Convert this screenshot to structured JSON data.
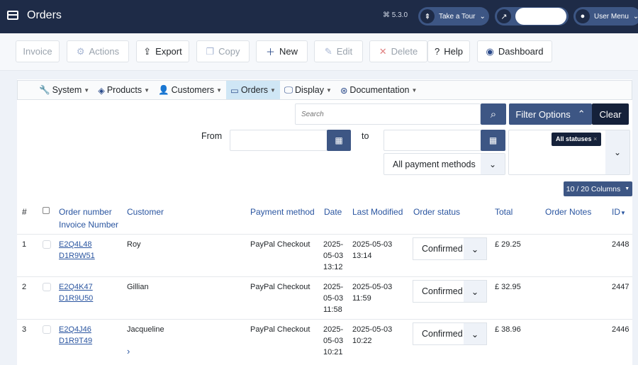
{
  "header": {
    "title": "Orders",
    "version": "5.3.0",
    "tour": "Take a Tour",
    "user_menu": "User Menu"
  },
  "toolbar": {
    "invoice": "Invoice",
    "actions": "Actions",
    "export": "Export",
    "copy": "Copy",
    "new": "New",
    "edit": "Edit",
    "delete": "Delete",
    "help": "Help",
    "dashboard": "Dashboard"
  },
  "menu": {
    "system": "System",
    "products": "Products",
    "customers": "Customers",
    "orders": "Orders",
    "display": "Display",
    "documentation": "Documentation"
  },
  "filters": {
    "search_placeholder": "Search",
    "filter_options": "Filter Options",
    "clear": "Clear",
    "from": "From",
    "to": "to",
    "payment": "All payment methods",
    "status_tag": "All statuses",
    "columns": "10 / 20  Columns"
  },
  "table": {
    "headers": {
      "num": "#",
      "order": "Order number",
      "invoice": "Invoice Number",
      "customer": "Customer",
      "payment": "Payment method",
      "date": "Date",
      "modified": "Last Modified",
      "status": "Order status",
      "total": "Total",
      "notes": "Order Notes",
      "id": "ID"
    },
    "rows": [
      {
        "num": "1",
        "order": "E2Q4L48",
        "invoice": "D1R9W51",
        "customer": "Roy",
        "payment": "PayPal Checkout",
        "date1": "2025-",
        "date2": "05-03",
        "date3": "13:12",
        "mod1": "2025-05-03",
        "mod2": "13:14",
        "status": "Confirmed",
        "total": "£ 29.25",
        "id": "2448"
      },
      {
        "num": "2",
        "order": "E2Q4K47",
        "invoice": "D1R9U50",
        "customer": "Gillian",
        "payment": "PayPal Checkout",
        "date1": "2025-",
        "date2": "05-03",
        "date3": "11:58",
        "mod1": "2025-05-03",
        "mod2": "11:59",
        "status": "Confirmed",
        "total": "£ 32.95",
        "id": "2447"
      },
      {
        "num": "3",
        "order": "E2Q4J46",
        "invoice": "D1R9T49",
        "customer": "Jacqueline",
        "payment": "PayPal Checkout",
        "date1": "2025-",
        "date2": "05-03",
        "date3": "10:21",
        "mod1": "2025-05-03",
        "mod2": "10:22",
        "status": "Confirmed",
        "total": "£ 38.96",
        "id": "2446"
      }
    ]
  }
}
